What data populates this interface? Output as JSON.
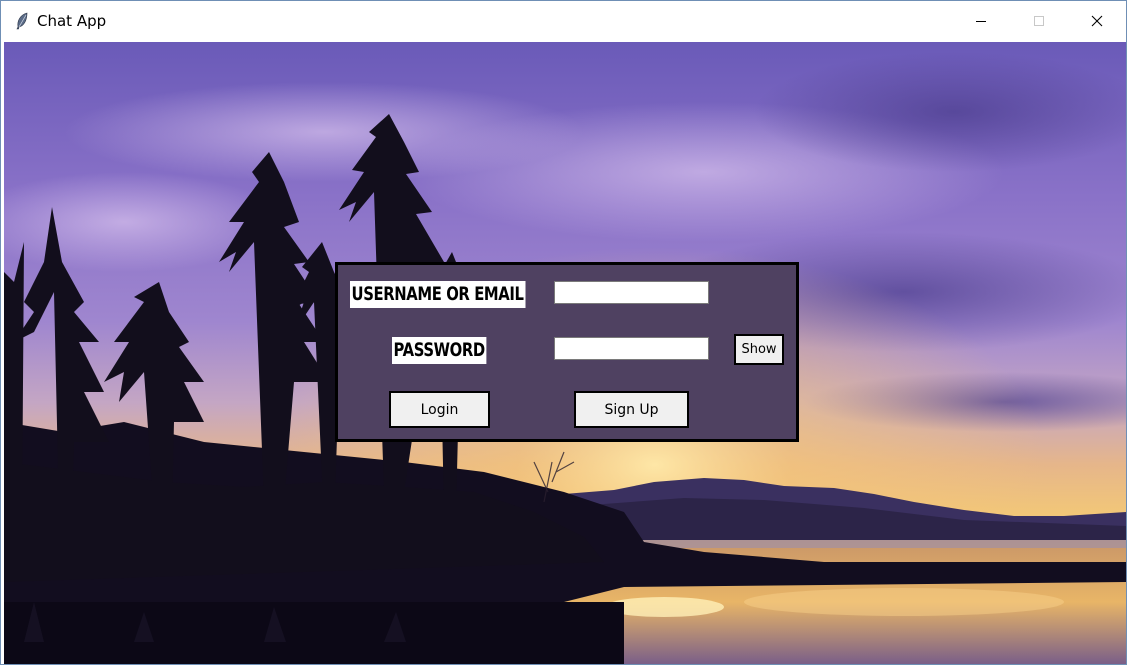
{
  "window": {
    "title": "Chat App",
    "icons": {
      "app": "feather-icon",
      "minimize": "minimize-icon",
      "maximize": "maximize-icon",
      "close": "close-icon"
    }
  },
  "login_form": {
    "username_label": "USERNAME OR EMAIL",
    "username_value": "",
    "password_label": "PASSWORD",
    "password_value": "",
    "show_button": "Show",
    "login_button": "Login",
    "signup_button": "Sign Up"
  },
  "colors": {
    "panel_background": "#4f4161",
    "panel_border": "#000000",
    "button_background": "#f0f0f0",
    "label_background": "#ffffff"
  }
}
